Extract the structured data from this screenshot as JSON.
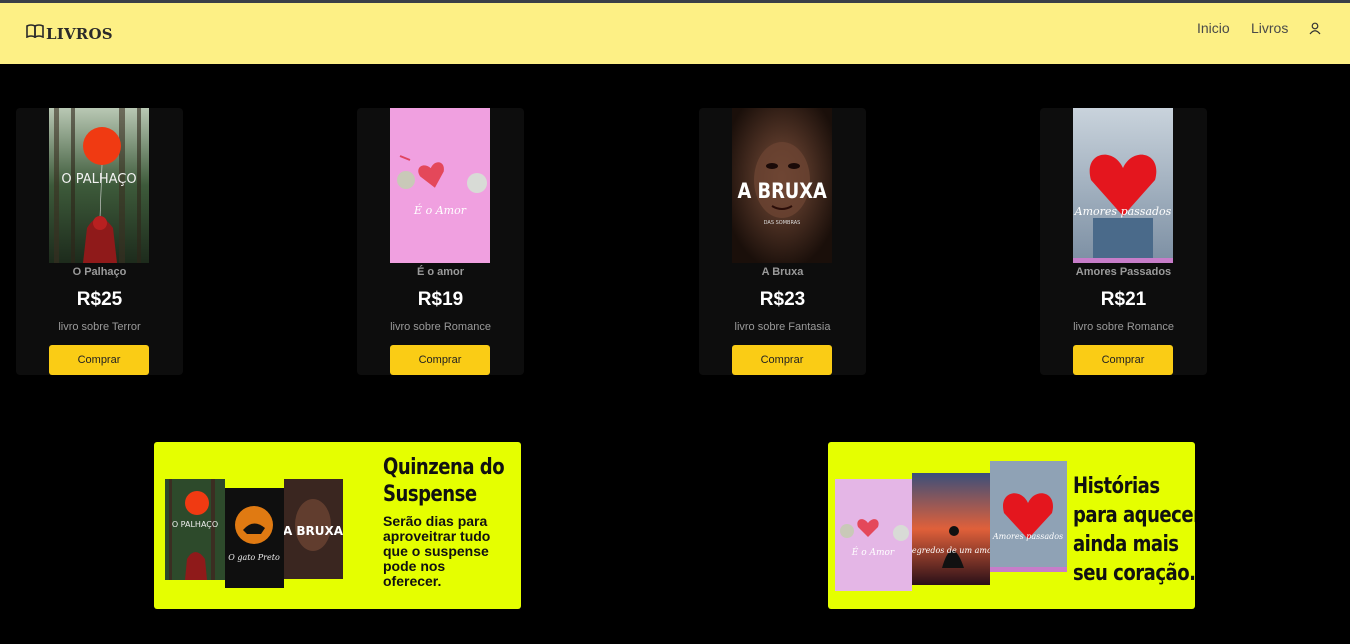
{
  "header": {
    "brand": "LIVROS",
    "brand_icon": "book-open-icon",
    "nav": [
      {
        "label": "Inicio"
      },
      {
        "label": "Livros"
      }
    ],
    "user_icon": "user-icon"
  },
  "products": [
    {
      "title": "O Palhaço",
      "price": "R$25",
      "description": "livro sobre Terror",
      "button": "Comprar",
      "cover_title": "O PALHAÇO"
    },
    {
      "title": "É o amor",
      "price": "R$19",
      "description": "livro sobre Romance",
      "button": "Comprar",
      "cover_title": "É o Amor"
    },
    {
      "title": "A Bruxa",
      "price": "R$23",
      "description": "livro sobre Fantasia",
      "button": "Comprar",
      "cover_title": "A BRUXA",
      "cover_subtitle": "DAS SOMBRAS"
    },
    {
      "title": "Amores Passados",
      "price": "R$21",
      "description": "livro sobre Romance",
      "button": "Comprar",
      "cover_title": "Amores passados"
    }
  ],
  "promos": [
    {
      "title": "Quinzena do Suspense",
      "text": "Serão dias para aproveitrar tudo que o suspense pode nos oferecer.",
      "covers": [
        "O PALHAÇO",
        "O gato Preto",
        "A BRUXA"
      ]
    },
    {
      "title": "Histórias para aquecer ainda mais seu coração.",
      "covers": [
        "É o Amor",
        "Segredos de um amor",
        "Amores passados"
      ]
    }
  ],
  "colors": {
    "navbar": "#fdf085",
    "page_bg": "#000000",
    "card_bg": "#0d0d0d",
    "button": "#facc15",
    "promo_bg": "#e5ff00"
  }
}
